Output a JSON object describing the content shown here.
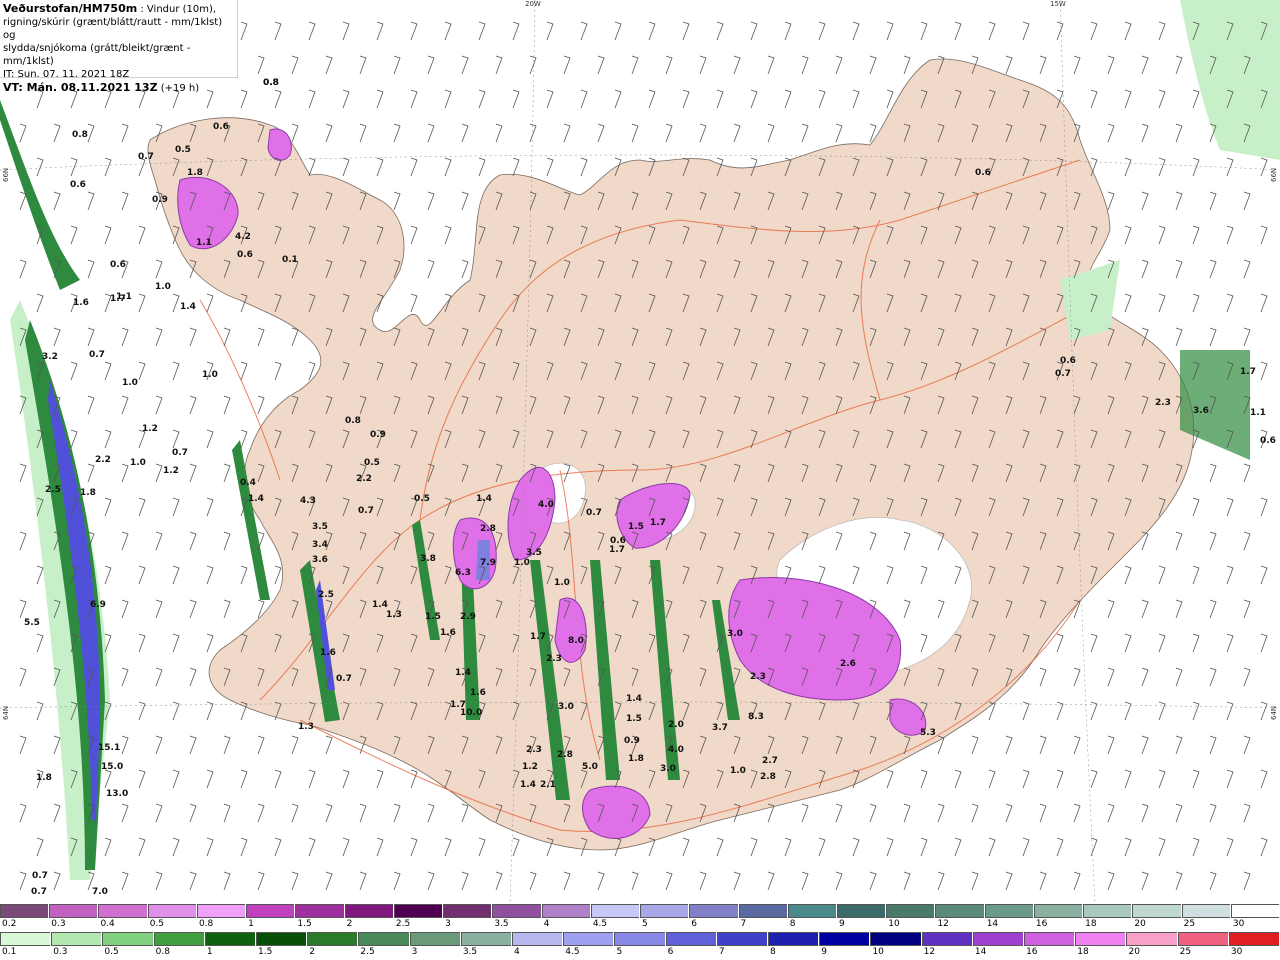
{
  "header": {
    "line1_bold": "Veðurstofan/HM750m",
    "line1_rest": " : Vindur (10m),",
    "line2": "rigning/skúrir (grænt/blátt/rautt - mm/1klst) og",
    "line3": "slydda/snjókoma (grátt/bleikt/grænt - mm/1klst)",
    "line4": "IT: Sun. 07. 11. 2021 18Z",
    "line5_bold": "VT: Mán. 08.11.2021 13Z",
    "line5_rest": " (+19 h)"
  },
  "grid_labels": {
    "top_20w": "20W",
    "top_15w": "15W",
    "left_66n": "66N",
    "left_64n": "64N",
    "right_66n": "66N",
    "right_64n": "64N"
  },
  "colors": {
    "land": "#f0d9c8",
    "roads": "#e8633a",
    "rain_light": "#c8f0c8",
    "rain_mid": "#2e8a3e",
    "rain_heavy": "#0c4a18",
    "snow": "#e070e8",
    "snow_dark": "#8b3aa8",
    "blue": "#5050d8"
  },
  "values": [
    "0.8",
    "0.8",
    "0.5",
    "0.7",
    "0.6",
    "0.6",
    "1.8",
    "0.9",
    "1.1",
    "4.2",
    "0.6",
    "0.1",
    "0.6",
    "1.0",
    "1.4",
    "1.1",
    "1.6",
    "1.7",
    "3.2",
    "0.7",
    "1.0",
    "1.0",
    "1.2",
    "0.7",
    "1.0",
    "1.2",
    "2.2",
    "2.5",
    "1.8",
    "0.4",
    "1.4",
    "4.3",
    "3.5",
    "3.4",
    "3.6",
    "5.5",
    "6.9",
    "2.5",
    "1.6",
    "0.7",
    "1.3",
    "0.8",
    "0.9",
    "0.5",
    "2.2",
    "0.7",
    "0.5",
    "1.4",
    "2.8",
    "4.0",
    "3.5",
    "1.0",
    "0.7",
    "1.7",
    "1.5",
    "1.7",
    "3.8",
    "7.9",
    "6.3",
    "0.6",
    "1.4",
    "1.3",
    "1.5",
    "1.6",
    "2.9",
    "1.0",
    "1.7",
    "8.0",
    "2.3",
    "1.4",
    "1.7",
    "1.6",
    "10.0",
    "3.0",
    "1.4",
    "1.5",
    "2.0",
    "4.0",
    "2.3",
    "2.8",
    "1.2",
    "5.0",
    "0.9",
    "1.8",
    "1.4",
    "2.1",
    "1.0",
    "2.7",
    "2.8",
    "3.0",
    "15.1",
    "15.0",
    "13.0",
    "1.8",
    "0.7",
    "0.7",
    "7.0",
    "0.6",
    "0.6",
    "0.7",
    "2.3",
    "3.6",
    "1.7",
    "1.1",
    "2.6",
    "0.6",
    "3.0",
    "2.3",
    "3.7",
    "8.3",
    "5.3",
    "0.8"
  ],
  "legend_snow": [
    "0.2",
    "0.3",
    "0.4",
    "0.5",
    "0.8",
    "1",
    "1.5",
    "2",
    "2.5",
    "3",
    "3.5",
    "4",
    "4.5",
    "5",
    "6",
    "7",
    "8",
    "9",
    "10",
    "12",
    "14",
    "16",
    "18",
    "20",
    "25",
    "30"
  ],
  "legend_rain": [
    "0.1",
    "0.3",
    "0.5",
    "0.8",
    "1",
    "1.5",
    "2",
    "2.5",
    "3",
    "3.5",
    "4",
    "4.5",
    "5",
    "6",
    "7",
    "8",
    "9",
    "10",
    "12",
    "14",
    "16",
    "18",
    "20",
    "25",
    "30"
  ],
  "legend_snow_colors": [
    "#7a4a7a",
    "#c060c0",
    "#d070d0",
    "#e090e8",
    "#f0a0f8",
    "#c040c0",
    "#a030a0",
    "#801880",
    "#500050",
    "#703070",
    "#9050a0",
    "#b080c8",
    "#c8c8f8",
    "#a8a8e8",
    "#8080c8",
    "#5a6aa0",
    "#4a8a8a",
    "#3a6a6a",
    "#4a7a6a",
    "#5a8a7a",
    "#6a9a8a",
    "#8ab0a0",
    "#a8c8c0",
    "#c0d8d0",
    "#d0e0e0",
    "#ffffff"
  ],
  "legend_rain_colors": [
    "#d8f8d8",
    "#b0e8b0",
    "#80d080",
    "#40a040",
    "#106010",
    "#085008",
    "#2a7a2a",
    "#4a8a5a",
    "#6a9a7a",
    "#8ab0a0",
    "#b8b8f0",
    "#a0a0f0",
    "#8888e8",
    "#6060d8",
    "#4040c8",
    "#2020b0",
    "#0000a0",
    "#000080",
    "#6030c0",
    "#a040d0",
    "#d060e0",
    "#f080f0",
    "#f8a0c8",
    "#f06080",
    "#e02020"
  ]
}
